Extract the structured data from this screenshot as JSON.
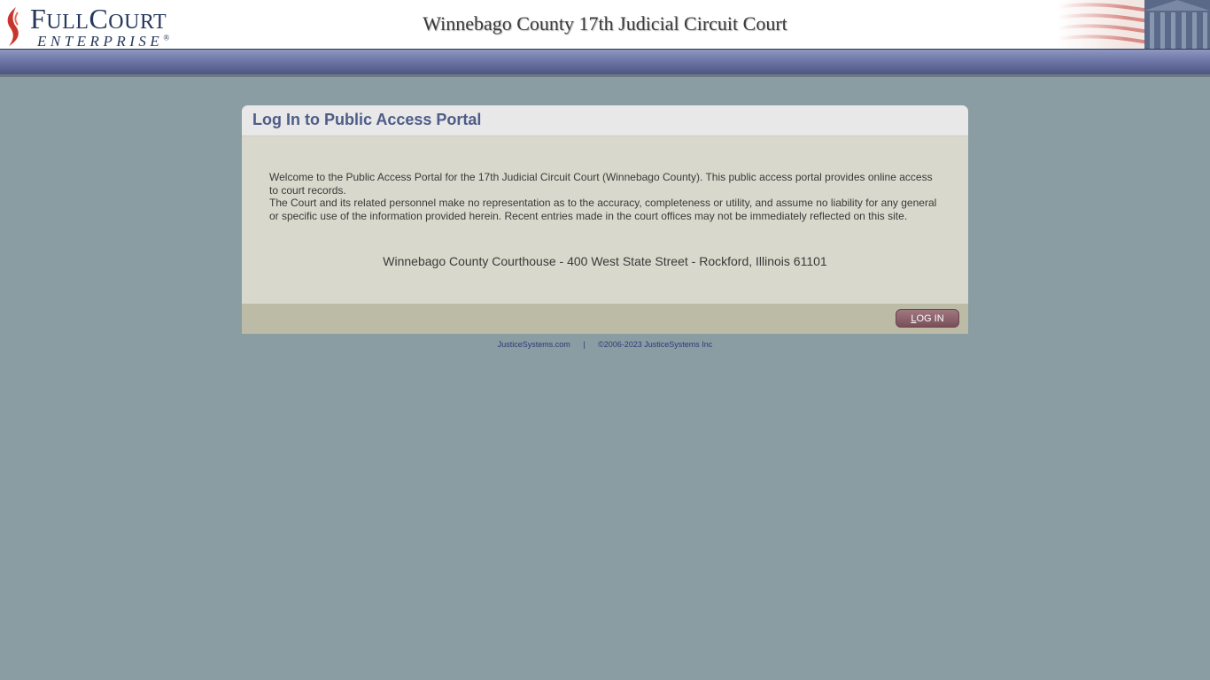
{
  "header": {
    "logo_main_first": "F",
    "logo_main_rest1": "ULL",
    "logo_main_c": "C",
    "logo_main_rest2": "OURT",
    "logo_sub": "ENTERPRISE",
    "logo_reg": "®",
    "court_title": "Winnebago County 17th Judicial Circuit Court"
  },
  "panel": {
    "title": "Log In to Public Access Portal",
    "welcome_line1": "Welcome to the Public Access Portal for the 17th Judicial Circuit Court (Winnebago County). This public access portal provides online access to court records.",
    "welcome_line2": "The Court and its related personnel make no representation as to the accuracy, completeness or utility, and assume no liability for any general or specific use of the information provided herein. Recent entries made in the court offices may not be immediately reflected on this site.",
    "address": "Winnebago County Courthouse - 400 West State Street - Rockford, Illinois 61101",
    "login_first": "L",
    "login_rest": "OG IN"
  },
  "footer": {
    "link": "JusticeSystems.com",
    "separator": "|",
    "copyright": "©2006-2023 JusticeSystems Inc"
  },
  "colors": {
    "background": "#8a9da3",
    "title": "#4e5c88",
    "navbar": "#6d76a6",
    "login_button": "#7a4f59"
  }
}
